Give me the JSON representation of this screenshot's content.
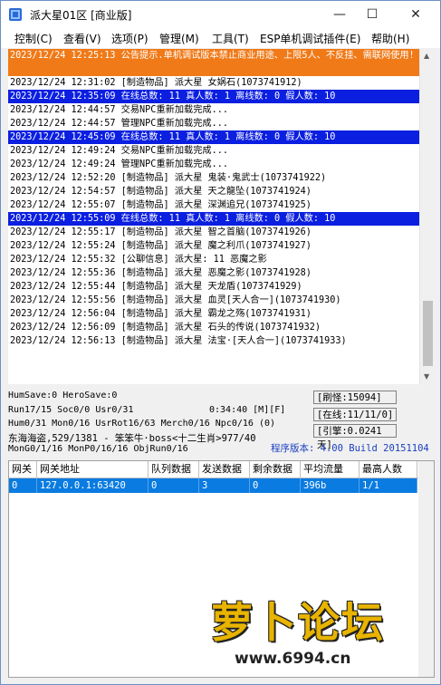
{
  "window": {
    "title": "派大星01区 [商业版]",
    "controls": {
      "minimize": "—",
      "maximize": "☐",
      "close": "✕"
    }
  },
  "menu": [
    "控制(C)",
    "查看(V)",
    "选项(P)",
    "管理(M)",
    "工具(T)",
    "ESP单机调试插件(E)",
    "帮助(H)"
  ],
  "log": [
    {
      "text": "2023/12/24 12:25:13 公告提示.单机调试版本禁止商业用途、上限5人、不反挂、需联网使用!",
      "style": "orange"
    },
    {
      "text": "2023/12/24 12:31:02 [制造物品] 派大星 女娲石(1073741912)",
      "style": "normal"
    },
    {
      "text": "2023/12/24 12:35:09 在线总数: 11 真人数: 1 离线数: 0 假人数: 10",
      "style": "blue"
    },
    {
      "text": "2023/12/24 12:44:57 交易NPC重新加载完成...",
      "style": "normal"
    },
    {
      "text": "2023/12/24 12:44:57 管理NPC重新加载完成...",
      "style": "normal"
    },
    {
      "text": "2023/12/24 12:45:09 在线总数: 11 真人数: 1 离线数: 0 假人数: 10",
      "style": "blue"
    },
    {
      "text": "2023/12/24 12:49:24 交易NPC重新加载完成...",
      "style": "normal"
    },
    {
      "text": "2023/12/24 12:49:24 管理NPC重新加载完成...",
      "style": "normal"
    },
    {
      "text": "2023/12/24 12:52:20 [制造物品] 派大星 鬼装·鬼武士(1073741922)",
      "style": "normal"
    },
    {
      "text": "2023/12/24 12:54:57 [制造物品] 派大星 天之龍坠(1073741924)",
      "style": "normal"
    },
    {
      "text": "2023/12/24 12:55:07 [制造物品] 派大星 深渊追兄(1073741925)",
      "style": "normal"
    },
    {
      "text": "2023/12/24 12:55:09 在线总数: 11 真人数: 1 离线数: 0 假人数: 10",
      "style": "blue"
    },
    {
      "text": "2023/12/24 12:55:17 [制造物品] 派大星 智之首脑(1073741926)",
      "style": "normal"
    },
    {
      "text": "2023/12/24 12:55:24 [制造物品] 派大星 魔之利爪(1073741927)",
      "style": "normal"
    },
    {
      "text": "2023/12/24 12:55:32 [公聊信息] 派大星: 11 恶魔之影",
      "style": "normal"
    },
    {
      "text": "2023/12/24 12:55:36 [制造物品] 派大星 恶魔之影(1073741928)",
      "style": "normal"
    },
    {
      "text": "2023/12/24 12:55:44 [制造物品] 派大星 天龙盾(1073741929)",
      "style": "normal"
    },
    {
      "text": "2023/12/24 12:55:56 [制造物品] 派大星 血灵[天人合一](1073741930)",
      "style": "normal"
    },
    {
      "text": "2023/12/24 12:56:04 [制造物品] 派大星 霸龙之殇(1073741931)",
      "style": "normal"
    },
    {
      "text": "2023/12/24 12:56:09 [制造物品] 派大星 石头的传说(1073741932)",
      "style": "normal"
    },
    {
      "text": "2023/12/24 12:56:13 [制造物品] 派大星 法宝·[天人合一](1073741933)",
      "style": "normal"
    }
  ],
  "stats": {
    "line1": "HumSave:0 HeroSave:0",
    "line2": "Run17/15 Soc0/0 Usr0/31",
    "time": "0:34:40 [M][F]",
    "line3": "Hum0/31 Mon0/16 UsrRot16/63 Merch0/16 Npc0/16 (0)",
    "line4": "东海海盗,529/1381 - 笨笨牛·boss<十二生肖>977/40",
    "line5": "MonG0/1/16 MonP0/16/16 ObjRun0/16",
    "refresh": "[刷怪:15094]",
    "online": "[在线:11/11/0]",
    "engine": "[引擎:0.0241天]",
    "version": "程序版本: 4.00 Build 20151104"
  },
  "table": {
    "headers": [
      "网关",
      "网关地址",
      "队列数据",
      "发送数据",
      "剩余数据",
      "平均流量",
      "最高人数"
    ],
    "rows": [
      [
        "0",
        "127.0.0.1:63420",
        "0",
        "3",
        "0",
        "396b",
        "1/1"
      ]
    ]
  },
  "watermark": {
    "text": "萝卜论坛",
    "url": "www.6994.cn"
  },
  "colors": {
    "highlight_blue": "#0b1fe0",
    "notice_orange": "#f07a18",
    "selection_blue": "#0a7be0"
  }
}
